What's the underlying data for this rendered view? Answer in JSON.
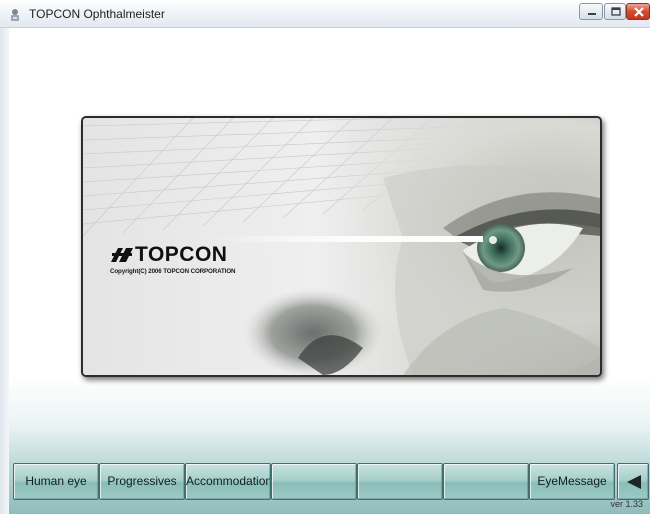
{
  "window": {
    "title": "TOPCON Ophthalmeister",
    "controls": [
      "minimize-icon",
      "maximize-icon",
      "close-icon"
    ],
    "close_color": "#d5492f"
  },
  "splash": {
    "logo": "TOPCON",
    "copyright": "Copyright(C) 2006 TOPCON CORPORATION"
  },
  "toolbar": {
    "buttons": [
      {
        "label": "Human eye"
      },
      {
        "label": "Progressives"
      },
      {
        "label": "Accommodation"
      },
      {
        "label": ""
      },
      {
        "label": ""
      },
      {
        "label": ""
      },
      {
        "label": "EyeMessage"
      }
    ],
    "back_icon": "triangle-left-icon",
    "accent": "#9ccac5"
  },
  "footer": {
    "version": "ver 1.33"
  }
}
